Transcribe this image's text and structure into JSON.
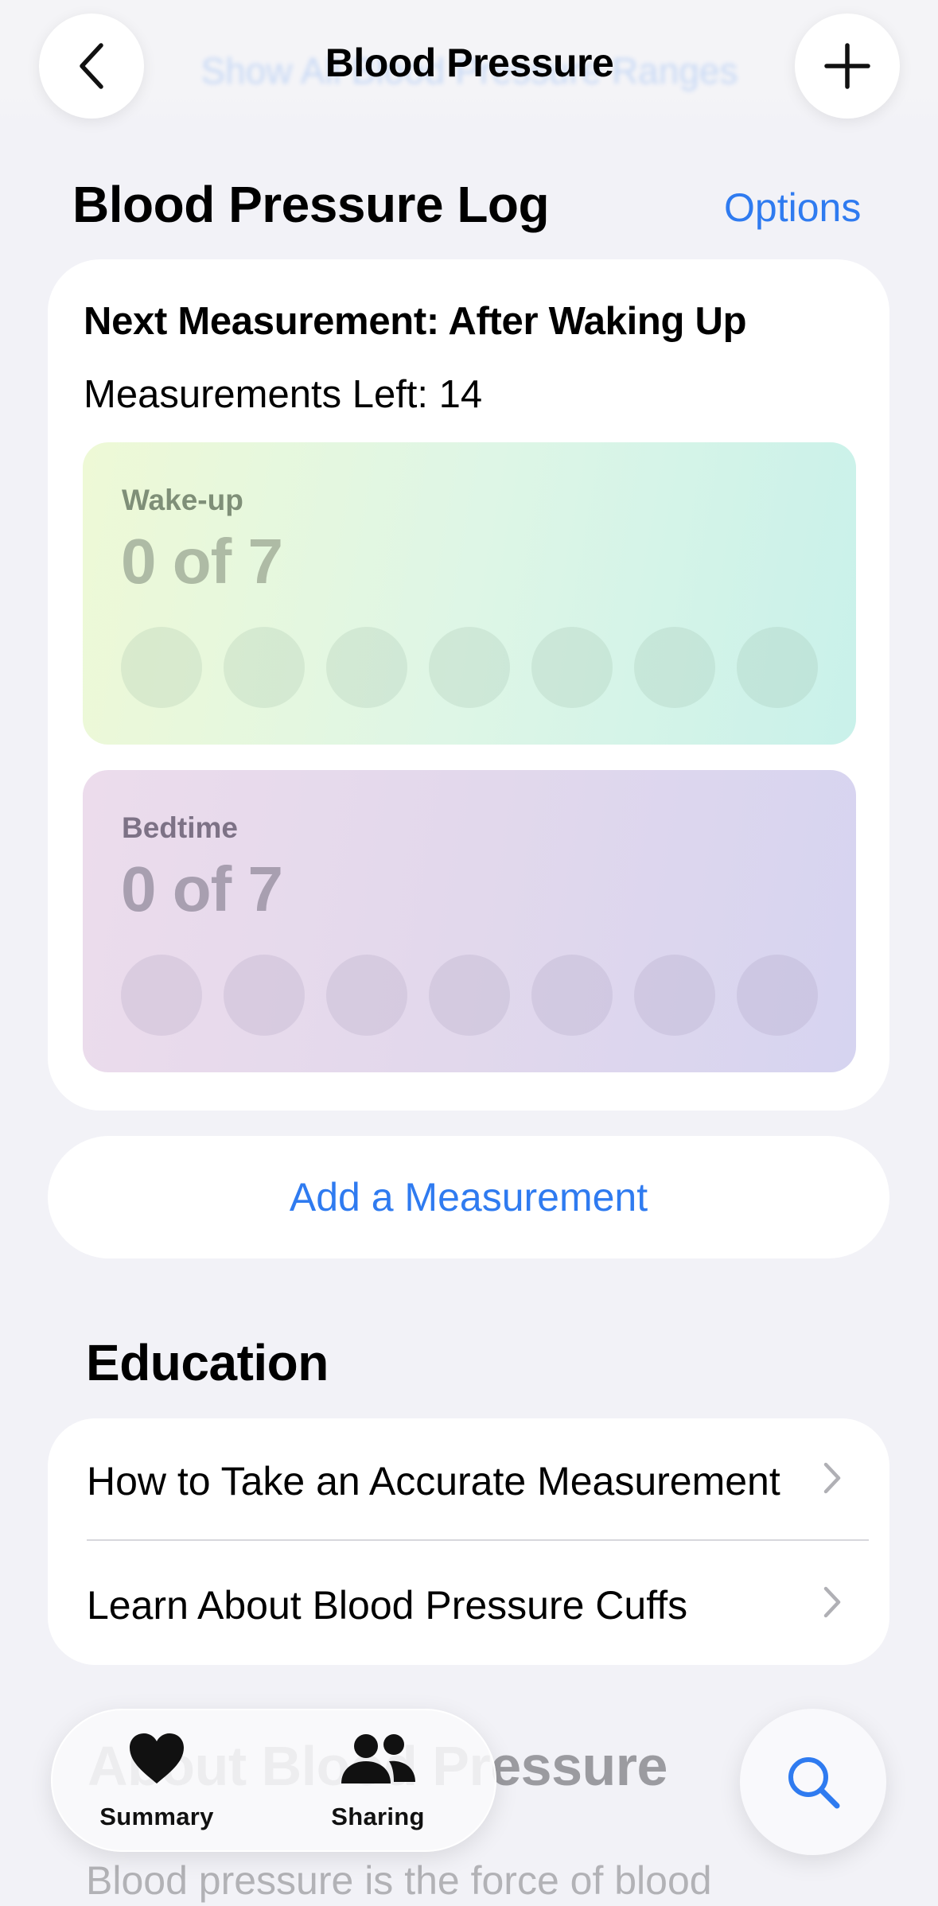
{
  "nav": {
    "title": "Blood Pressure",
    "behind_link": "Show All Blood Pressure Ranges",
    "back_icon": "chevron-left-icon",
    "add_icon": "plus-icon"
  },
  "log": {
    "title": "Blood Pressure Log",
    "options_label": "Options",
    "next_measurement": "Next Measurement: After Waking Up",
    "measurements_left": "Measurements Left: 14",
    "wake": {
      "label": "Wake-up",
      "count": "0 of 7",
      "completed": 0,
      "total": 7
    },
    "bed": {
      "label": "Bedtime",
      "count": "0 of 7",
      "completed": 0,
      "total": 7
    }
  },
  "add_measurement_label": "Add a Measurement",
  "education": {
    "title": "Education",
    "items": [
      {
        "label": "How to Take an Accurate Measurement"
      },
      {
        "label": "Learn About Blood Pressure Cuffs"
      }
    ]
  },
  "about": {
    "title": "About Blood Pressure",
    "body": "Blood pressure is the force of blood"
  },
  "tabbar": {
    "tabs": [
      {
        "label": "Summary",
        "icon": "heart-icon"
      },
      {
        "label": "Sharing",
        "icon": "people-icon"
      }
    ],
    "search_icon": "search-icon"
  },
  "colors": {
    "accent": "#2f7bf0",
    "background": "#f2f2f7"
  }
}
